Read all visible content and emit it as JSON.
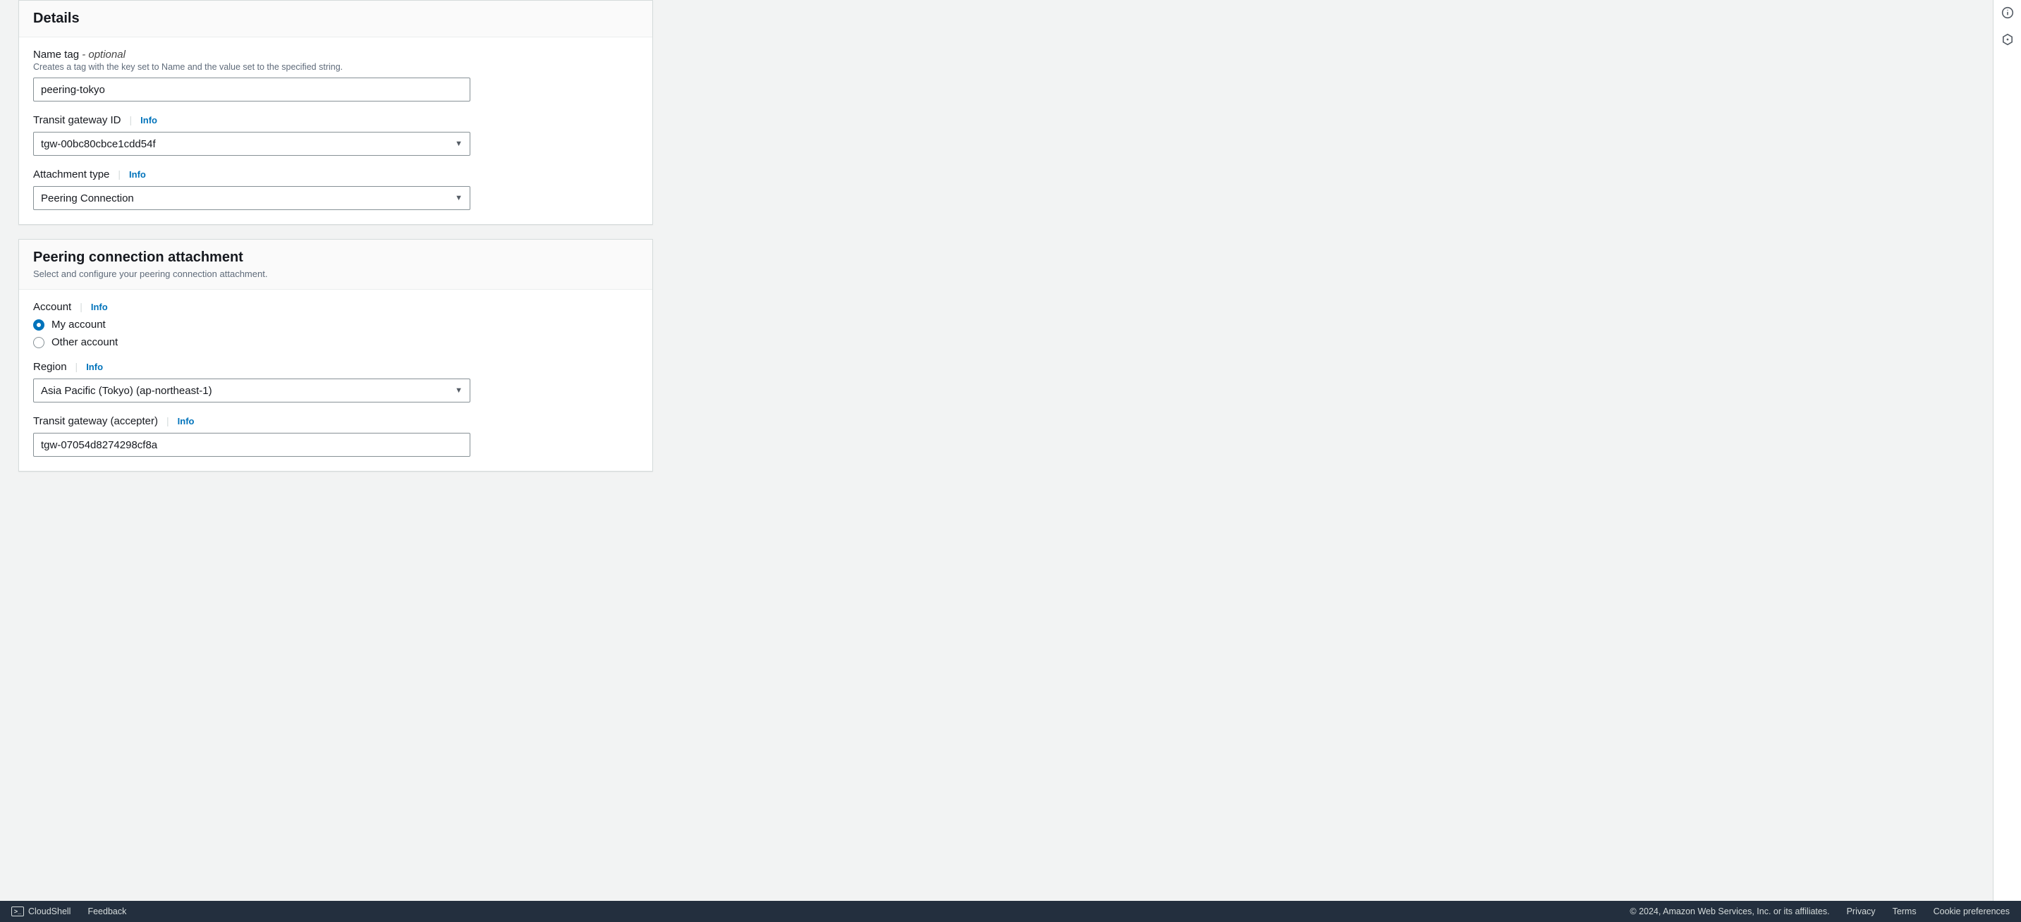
{
  "details": {
    "title": "Details",
    "name_tag": {
      "label": "Name tag",
      "optional_suffix": " - optional",
      "hint": "Creates a tag with the key set to Name and the value set to the specified string.",
      "value": "peering-tokyo"
    },
    "tgw_id": {
      "label": "Transit gateway ID",
      "info": "Info",
      "value": "tgw-00bc80cbce1cdd54f"
    },
    "attachment_type": {
      "label": "Attachment type",
      "info": "Info",
      "value": "Peering Connection"
    }
  },
  "peering": {
    "title": "Peering connection attachment",
    "desc": "Select and configure your peering connection attachment.",
    "account": {
      "label": "Account",
      "info": "Info",
      "my_account": "My account",
      "other_account": "Other account"
    },
    "region": {
      "label": "Region",
      "info": "Info",
      "value": "Asia Pacific (Tokyo) (ap-northeast-1)"
    },
    "accepter": {
      "label": "Transit gateway (accepter)",
      "info": "Info",
      "value": "tgw-07054d8274298cf8a"
    }
  },
  "footer": {
    "cloudshell": "CloudShell",
    "feedback": "Feedback",
    "copyright": "© 2024, Amazon Web Services, Inc. or its affiliates.",
    "privacy": "Privacy",
    "terms": "Terms",
    "cookie": "Cookie preferences"
  }
}
